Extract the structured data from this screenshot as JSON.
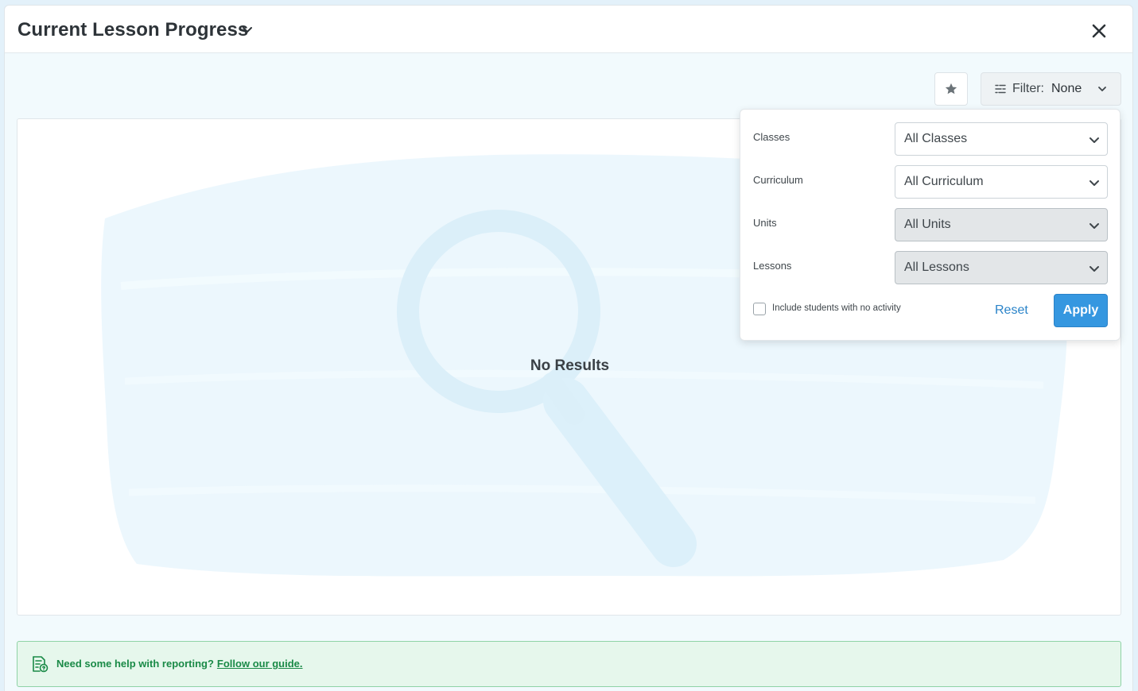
{
  "header": {
    "title": "Current Lesson Progress"
  },
  "toolbar": {
    "filter_label": "Filter:",
    "filter_value": "None"
  },
  "content": {
    "empty_message": "No Results"
  },
  "filter_panel": {
    "rows": [
      {
        "label": "Classes",
        "value": "All Classes",
        "disabled": false
      },
      {
        "label": "Curriculum",
        "value": "All Curriculum",
        "disabled": false
      },
      {
        "label": "Units",
        "value": "All Units",
        "disabled": true
      },
      {
        "label": "Lessons",
        "value": "All Lessons",
        "disabled": true
      }
    ],
    "include_inactive_label": "Include students with no activity",
    "include_inactive_checked": false,
    "reset_label": "Reset",
    "apply_label": "Apply"
  },
  "help_banner": {
    "text": "Need some help with reporting?",
    "link_text": "Follow our guide."
  },
  "colors": {
    "accent": "#3597e0",
    "link": "#2b84c9",
    "help_green": "#1a8a47",
    "help_bg": "#e6f7ec"
  }
}
